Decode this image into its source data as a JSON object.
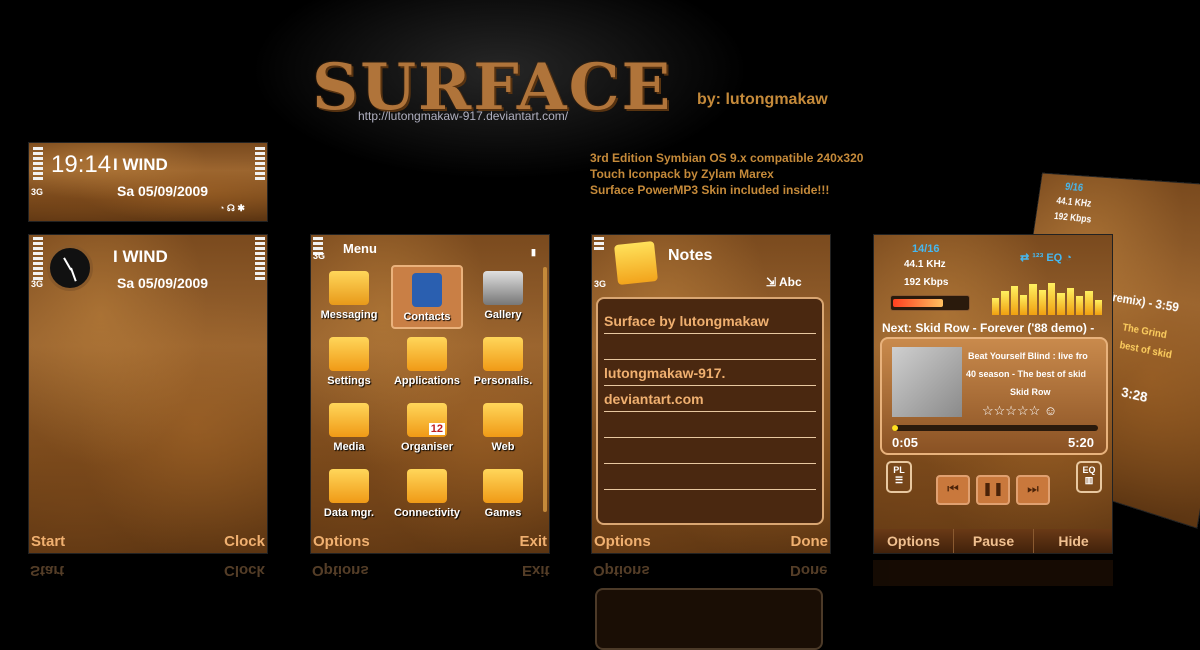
{
  "header": {
    "title": "SURFACE",
    "url": "http://lutongmakaw-917.deviantart.com/",
    "byline": "by:  lutongmakaw",
    "info": [
      "3rd Edition Symbian OS 9.x compatible 240x320",
      "Touch Iconpack by Zylam Marex",
      "Surface PowerMP3 Skin included  inside!!!"
    ]
  },
  "standby_small": {
    "time": "19:14",
    "operator": "I WIND",
    "date": "Sa 05/09/2009",
    "net": "3G"
  },
  "standby": {
    "operator": "I WIND",
    "date": "Sa 05/09/2009",
    "net": "3G",
    "left_soft": "Start",
    "right_soft": "Clock"
  },
  "menu": {
    "title": "Menu",
    "net": "3G",
    "items": [
      {
        "label": "Messaging"
      },
      {
        "label": "Contacts"
      },
      {
        "label": "Gallery"
      },
      {
        "label": "Settings"
      },
      {
        "label": "Applications"
      },
      {
        "label": "Personalis."
      },
      {
        "label": "Media"
      },
      {
        "label": "Organiser"
      },
      {
        "label": "Web"
      },
      {
        "label": "Data mgr."
      },
      {
        "label": "Connectivity"
      },
      {
        "label": "Games"
      }
    ],
    "organiser_day": "12",
    "left_soft": "Options",
    "right_soft": "Exit"
  },
  "notes": {
    "title": "Notes",
    "net": "3G",
    "mode": "Abc",
    "lines": [
      "Surface by lutongmakaw",
      "",
      "lutongmakaw-917.",
      "deviantart.com"
    ],
    "left_soft": "Options",
    "right_soft": "Done"
  },
  "player": {
    "track_index": "14/16",
    "khz": "44.1 KHz",
    "kbps": "192 Kbps",
    "eq_label": "EQ",
    "next_label": "Next:  Skid Row - Forever ('88 demo) -",
    "song_lines": [
      "Beat Yourself Blind : live fro",
      "40 season - The best of skid",
      "Skid Row"
    ],
    "rating": "☆☆☆☆☆ ☺",
    "elapsed": "0:05",
    "total": "5:20",
    "progress": 0.02,
    "pl_label": "PL",
    "eq_button": "EQ",
    "buttons": [
      "Options",
      "Pause",
      "Hide"
    ]
  },
  "player_tilted": {
    "track_index": "9/16",
    "khz": "44.1 KHz",
    "kbps": "192 Kbps",
    "next_fragment": "(remix) - 3:59",
    "lines": [
      "The Grind",
      "best of skid"
    ],
    "time": "3:28"
  }
}
